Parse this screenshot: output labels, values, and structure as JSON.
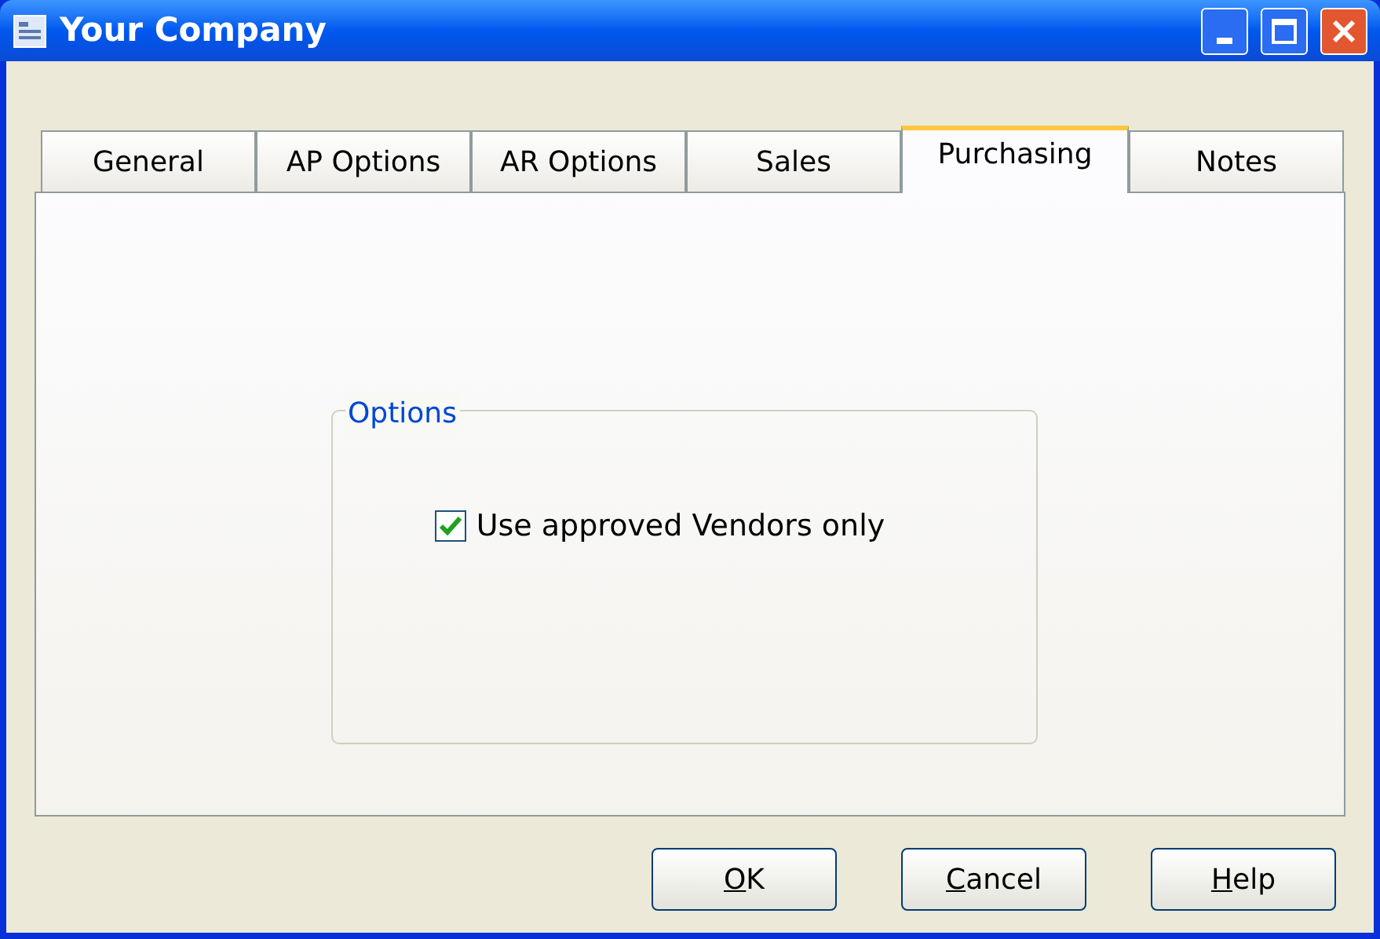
{
  "window": {
    "title": "Your Company"
  },
  "tabs": [
    {
      "label": "General",
      "selected": false
    },
    {
      "label": "AP Options",
      "selected": false
    },
    {
      "label": "AR Options",
      "selected": false
    },
    {
      "label": "Sales",
      "selected": false
    },
    {
      "label": "Purchasing",
      "selected": true
    },
    {
      "label": "Notes",
      "selected": false
    }
  ],
  "group": {
    "title": "Options",
    "checkbox": {
      "label": "Use approved Vendors only",
      "checked": true
    }
  },
  "buttons": [
    {
      "mnemonic": "O",
      "rest": "K"
    },
    {
      "mnemonic": "C",
      "rest": "ancel"
    },
    {
      "mnemonic": "H",
      "rest": "elp"
    }
  ]
}
